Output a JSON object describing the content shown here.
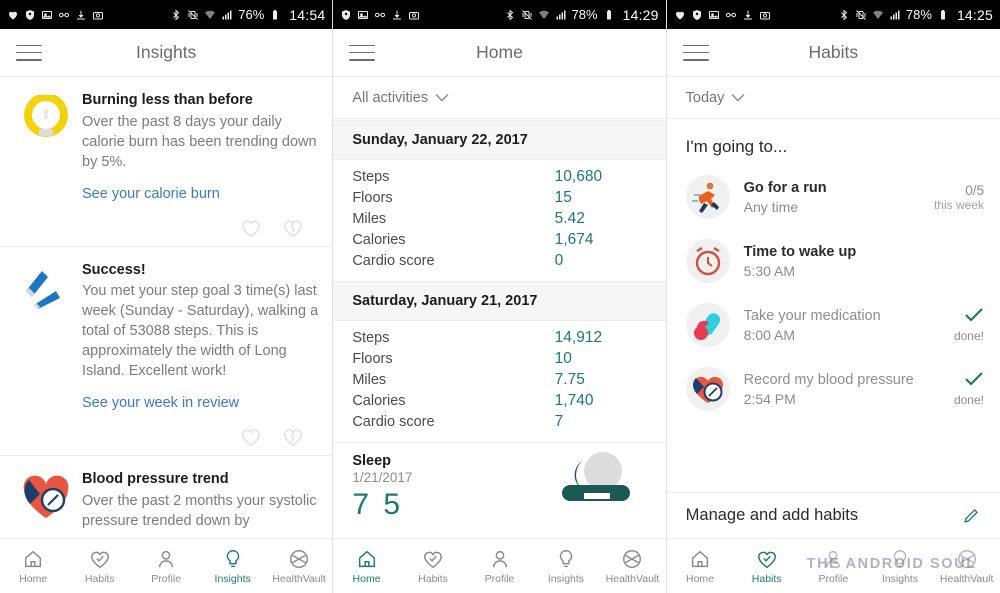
{
  "panels": [
    {
      "statusbar": {
        "left_icons": [
          "heart-icon",
          "shield-icon",
          "screenshot-icon",
          "glasses-icon",
          "download-icon",
          "camera-icon"
        ],
        "right_icons": [
          "bluetooth-icon",
          "vibrate-off-icon",
          "wifi-icon",
          "signal-icon"
        ],
        "battery": "76%",
        "time": "14:54"
      },
      "appbar": {
        "menu_icon": "hamburger-icon",
        "title": "Insights"
      },
      "cards": [
        {
          "icon": "lightbulb-icon",
          "title": "Burning less than before",
          "text": "Over the past 8 days your daily calorie burn has been trending down by 5%.",
          "link": "See your calorie burn",
          "actions": [
            "heart-icon",
            "broken-heart-icon"
          ]
        },
        {
          "icon": "footsteps-icon",
          "title": "Success!",
          "text": "You met your step goal 3 time(s) last week (Sunday - Saturday), walking a total of 53088 steps. This is approximately the width of Long Island. Excellent work!",
          "link": "See your week in review",
          "actions": [
            "heart-icon",
            "broken-heart-icon"
          ]
        },
        {
          "icon": "blood-pressure-icon",
          "title": "Blood pressure trend",
          "text": "Over the past 2 months your systolic pressure trended down by",
          "link": "",
          "actions": []
        }
      ],
      "nav": [
        {
          "label": "Home",
          "icon": "home-icon",
          "active": false
        },
        {
          "label": "Habits",
          "icon": "heart-check-icon",
          "active": false
        },
        {
          "label": "Profile",
          "icon": "person-icon",
          "active": false
        },
        {
          "label": "Insights",
          "icon": "lightbulb-icon",
          "active": true
        },
        {
          "label": "HealthVault",
          "icon": "healthvault-icon",
          "active": false
        }
      ]
    },
    {
      "statusbar": {
        "left_icons": [
          "shield-icon",
          "screenshot-icon",
          "glasses-icon",
          "download-icon",
          "camera-icon"
        ],
        "right_icons": [
          "bluetooth-icon",
          "vibrate-off-icon",
          "wifi-icon",
          "signal-icon"
        ],
        "battery": "78%",
        "time": "14:29"
      },
      "appbar": {
        "menu_icon": "hamburger-icon",
        "title": "Home"
      },
      "filter": {
        "label": "All activities",
        "icon": "chevron-down-icon"
      },
      "days": [
        {
          "date": "Sunday, January 22, 2017",
          "metrics": [
            {
              "label": "Steps",
              "value": "10,680"
            },
            {
              "label": "Floors",
              "value": "15"
            },
            {
              "label": "Miles",
              "value": "5.42"
            },
            {
              "label": "Calories",
              "value": "1,674"
            },
            {
              "label": "Cardio score",
              "value": "0"
            }
          ]
        },
        {
          "date": "Saturday, January 21, 2017",
          "metrics": [
            {
              "label": "Steps",
              "value": "14,912"
            },
            {
              "label": "Floors",
              "value": "10"
            },
            {
              "label": "Miles",
              "value": "7.75"
            },
            {
              "label": "Calories",
              "value": "1,740"
            },
            {
              "label": "Cardio score",
              "value": "7"
            }
          ]
        }
      ],
      "sleep": {
        "title": "Sleep",
        "date": "1/21/2017",
        "value": "7 5",
        "icon": "moon-cloud-icon"
      },
      "nav": [
        {
          "label": "Home",
          "icon": "home-icon",
          "active": true
        },
        {
          "label": "Habits",
          "icon": "heart-check-icon",
          "active": false
        },
        {
          "label": "Profile",
          "icon": "person-icon",
          "active": false
        },
        {
          "label": "Insights",
          "icon": "lightbulb-icon",
          "active": false
        },
        {
          "label": "HealthVault",
          "icon": "healthvault-icon",
          "active": false
        }
      ]
    },
    {
      "statusbar": {
        "left_icons": [
          "heart-icon",
          "shield-icon",
          "screenshot-icon",
          "glasses-icon",
          "download-icon",
          "camera-icon"
        ],
        "right_icons": [
          "bluetooth-icon",
          "vibrate-off-icon",
          "wifi-icon",
          "signal-icon"
        ],
        "battery": "78%",
        "time": "14:25"
      },
      "appbar": {
        "menu_icon": "hamburger-icon",
        "title": "Habits"
      },
      "filter": {
        "label": "Today",
        "icon": "chevron-down-icon"
      },
      "section_title": "I'm going to...",
      "habits": [
        {
          "icon": "runner-icon",
          "name": "Go for a run",
          "sub": "Any time",
          "right_primary": "0/5",
          "right_secondary": "this week",
          "done": false,
          "muted": false
        },
        {
          "icon": "alarm-clock-icon",
          "name": "Time to wake up",
          "sub": "5:30 AM",
          "right_primary": "",
          "right_secondary": "",
          "done": false,
          "muted": false
        },
        {
          "icon": "pills-icon",
          "name": "Take your medication",
          "sub": "8:00 AM",
          "right_primary": "",
          "right_secondary": "done!",
          "done": true,
          "muted": true
        },
        {
          "icon": "blood-pressure-icon",
          "name": "Record my blood pressure",
          "sub": "2:54 PM",
          "right_primary": "",
          "right_secondary": "done!",
          "done": true,
          "muted": true
        }
      ],
      "manage": {
        "label": "Manage and add habits",
        "icon": "pencil-icon"
      },
      "watermark": "THE ANDROID SOUL",
      "nav": [
        {
          "label": "Home",
          "icon": "home-icon",
          "active": false
        },
        {
          "label": "Habits",
          "icon": "heart-check-icon",
          "active": true
        },
        {
          "label": "Profile",
          "icon": "person-icon",
          "active": false
        },
        {
          "label": "Insights",
          "icon": "lightbulb-icon",
          "active": false
        },
        {
          "label": "HealthVault",
          "icon": "healthvault-icon",
          "active": false
        }
      ]
    }
  ],
  "colors": {
    "accent": "#1a7a6e",
    "link": "#3b78c4",
    "muted": "#8b8b8b"
  }
}
